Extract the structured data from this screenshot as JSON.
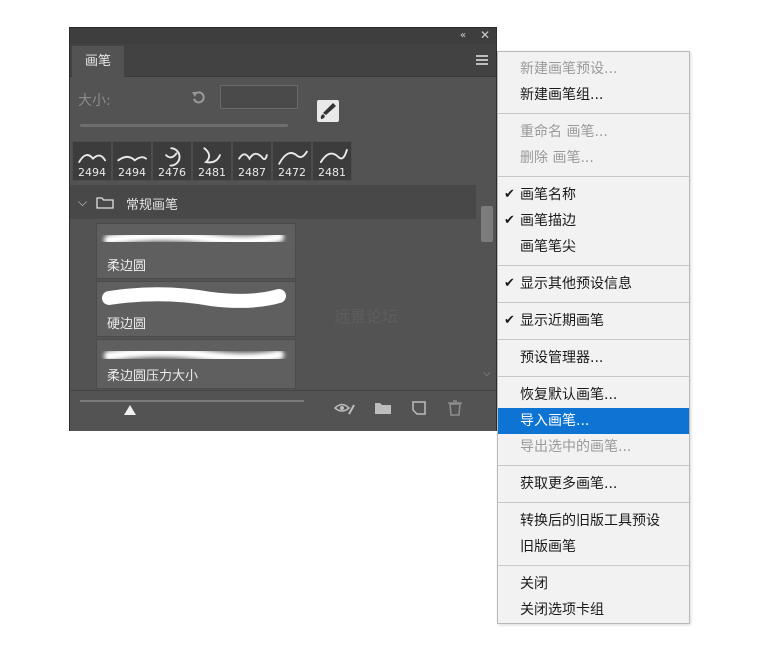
{
  "panel": {
    "tab_label": "画笔",
    "size_label": "大小:",
    "size_value": "",
    "recent_brushes": [
      {
        "number": "2494"
      },
      {
        "number": "2494"
      },
      {
        "number": "2476"
      },
      {
        "number": "2481"
      },
      {
        "number": "2487"
      },
      {
        "number": "2472"
      },
      {
        "number": "2481"
      }
    ],
    "group": {
      "label": "常规画笔"
    },
    "brushes": [
      {
        "name": "柔边圆"
      },
      {
        "name": "硬边圆"
      },
      {
        "name": "柔边圆压力大小"
      }
    ],
    "watermark": "远景论坛"
  },
  "menu": {
    "items": [
      {
        "label": "新建画笔预设...",
        "disabled": true
      },
      {
        "label": "新建画笔组..."
      },
      {
        "label": "重命名 画笔...",
        "disabled": true
      },
      {
        "label": "删除 画笔...",
        "disabled": true
      },
      {
        "label": "画笔名称",
        "checked": true
      },
      {
        "label": "画笔描边",
        "checked": true
      },
      {
        "label": "画笔笔尖"
      },
      {
        "label": "显示其他预设信息",
        "checked": true
      },
      {
        "label": "显示近期画笔",
        "checked": true
      },
      {
        "label": "预设管理器..."
      },
      {
        "label": "恢复默认画笔..."
      },
      {
        "label": "导入画笔...",
        "highlighted": true
      },
      {
        "label": "导出选中的画笔...",
        "disabled": true
      },
      {
        "label": "获取更多画笔..."
      },
      {
        "label": "转换后的旧版工具预设"
      },
      {
        "label": "旧版画笔"
      },
      {
        "label": "关闭"
      },
      {
        "label": "关闭选项卡组"
      }
    ]
  },
  "colors": {
    "highlight": "#0e74d4",
    "panel_bg": "#535353"
  }
}
